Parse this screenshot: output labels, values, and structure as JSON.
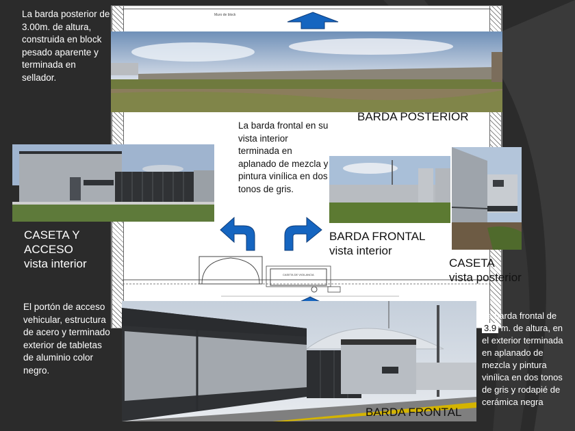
{
  "plan": {
    "top_label": "Muro de block",
    "booth_label": "CASETA DE VIGILANCIA"
  },
  "captions": {
    "barda_posterior_desc": "La barda posterior de 3.00m. de altura, construida en block pesado aparente y terminada en sellador.",
    "barda_posterior_title": "BARDA POSTERIOR",
    "barda_frontal_interior_desc": "La barda frontal en su vista interior terminada en aplanado de mezcla y pintura vinílica en dos tonos de gris.",
    "caseta_acceso_line1": "CASETA Y",
    "caseta_acceso_line2": "ACCESO",
    "caseta_acceso_line3": "vista interior",
    "barda_frontal_interior_line1": "BARDA FRONTAL",
    "barda_frontal_interior_line2": "vista interior",
    "caseta_posterior_line1": "CASETA",
    "caseta_posterior_line2": "vista posterior",
    "porton_desc": "El portón de acceso vehicular, estructura de acero y terminado exterior de tabletas de aluminio color negro.",
    "barda_frontal_ext_desc_pre": "La barda frontal de",
    "barda_frontal_ext_height": "3.9",
    "barda_frontal_ext_desc_post": "m. de altura, en el exterior terminada en aplanado de mezcla y pintura vinílica en dos tonos de gris y rodapié de cerámica negra",
    "barda_frontal_title": "BARDA FRONTAL"
  },
  "colors": {
    "arrow_blue": "#1565c0",
    "background": "#2b2b2b"
  }
}
